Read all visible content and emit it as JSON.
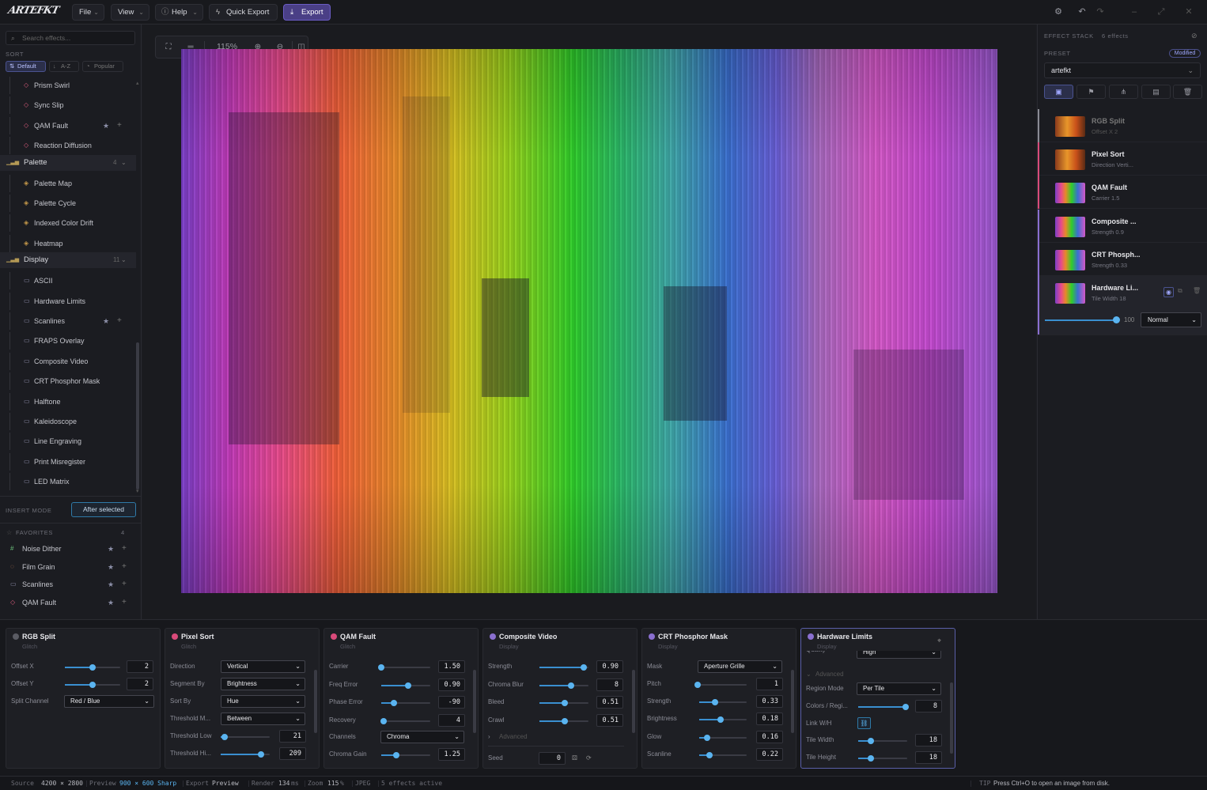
{
  "app": {
    "logo_text": "ARTEFKT"
  },
  "menu": {
    "file": "File",
    "view": "View",
    "help": "Help",
    "quick_export": "Quick Export",
    "export": "Export"
  },
  "sidebar": {
    "search_placeholder": "Search effects...",
    "sort_label": "SORT",
    "sort_options": [
      "Default",
      "A-Z",
      "Popular"
    ],
    "items_top": [
      "Prism Swirl",
      "Sync Slip",
      "QAM Fault",
      "Reaction Diffusion"
    ],
    "palette": {
      "label": "Palette",
      "count": "4",
      "items": [
        "Palette Map",
        "Palette Cycle",
        "Indexed Color Drift",
        "Heatmap"
      ]
    },
    "display": {
      "label": "Display",
      "count": "11",
      "items": [
        "ASCII",
        "Hardware Limits",
        "Scanlines",
        "FRAPS Overlay",
        "Composite Video",
        "CRT Phosphor Mask",
        "Halftone",
        "Kaleidoscope",
        "Line Engraving",
        "Print Misregister",
        "LED Matrix"
      ]
    },
    "insert_mode_label": "INSERT MODE",
    "insert_mode_value": "After selected",
    "favorites_label": "FAVORITES",
    "favorites_count": "4",
    "favorites": [
      "Noise Dither",
      "Film Grain",
      "Scanlines",
      "QAM Fault"
    ]
  },
  "canvas": {
    "zoom": "115%"
  },
  "effect_stack": {
    "title": "EFFECT STACK",
    "count": "6 effects",
    "preset_label": "PRESET",
    "modified": "Modified",
    "preset_value": "artefkt",
    "items": [
      {
        "name": "RGB Split",
        "sub": "Offset X 2",
        "color": "#8a8b94"
      },
      {
        "name": "Pixel Sort",
        "sub": "Direction Verti...",
        "color": "#d94a7a"
      },
      {
        "name": "QAM Fault",
        "sub": "Carrier 1.5",
        "color": "#d94a7a"
      },
      {
        "name": "Composite ...",
        "sub": "Strength 0.9",
        "color": "#8a6fd0"
      },
      {
        "name": "CRT Phosph...",
        "sub": "Strength 0.33",
        "color": "#8a6fd0"
      },
      {
        "name": "Hardware Li...",
        "sub": "Tile Width 18",
        "color": "#8a6fd0"
      }
    ],
    "opacity_value": "100",
    "blend_mode": "Normal"
  },
  "panels": {
    "rgb_split": {
      "title": "RGB Split",
      "category": "Glitch",
      "rows": [
        {
          "k": "Offset X",
          "v": "2",
          "p": 0.5
        },
        {
          "k": "Offset Y",
          "v": "2",
          "p": 0.5
        }
      ],
      "split_label": "Split Channel",
      "split_value": "Red / Blue"
    },
    "pixel_sort": {
      "title": "Pixel Sort",
      "category": "Glitch",
      "rows": [
        {
          "k": "Direction",
          "v": "Vertical"
        },
        {
          "k": "Segment By",
          "v": "Brightness"
        },
        {
          "k": "Sort By",
          "v": "Hue"
        },
        {
          "k": "Threshold M...",
          "v": "Between"
        }
      ],
      "t_low": {
        "k": "Threshold Low",
        "v": "21",
        "p": 0.08
      },
      "t_high": {
        "k": "Threshold Hi...",
        "v": "209",
        "p": 0.82
      }
    },
    "qam_fault": {
      "title": "QAM Fault",
      "category": "Glitch",
      "rows": [
        {
          "k": "Carrier",
          "v": "1.50",
          "p": 0.0
        },
        {
          "k": "Freq Error",
          "v": "0.90",
          "p": 0.55
        },
        {
          "k": "Phase Error",
          "v": "-90",
          "p": 0.25
        },
        {
          "k": "Recovery",
          "v": "4",
          "p": 0.05
        }
      ],
      "channels_label": "Channels",
      "channels_value": "Chroma",
      "gain": {
        "k": "Chroma Gain",
        "v": "1.25",
        "p": 0.3
      }
    },
    "composite": {
      "title": "Composite Video",
      "category": "Display",
      "rows": [
        {
          "k": "Strength",
          "v": "0.90",
          "p": 0.9
        },
        {
          "k": "Chroma Blur",
          "v": "8",
          "p": 0.65
        },
        {
          "k": "Bleed",
          "v": "0.51",
          "p": 0.51
        },
        {
          "k": "Crawl",
          "v": "0.51",
          "p": 0.51
        }
      ],
      "advanced": "Advanced",
      "seed_label": "Seed",
      "seed_value": "0"
    },
    "crt": {
      "title": "CRT Phosphor Mask",
      "category": "Display",
      "mask_label": "Mask",
      "mask_value": "Aperture Grille",
      "pitch": {
        "k": "Pitch",
        "v": "1",
        "p": 0.0
      },
      "rows": [
        {
          "k": "Strength",
          "v": "0.33",
          "p": 0.33
        },
        {
          "k": "Brightness",
          "v": "0.18",
          "p": 0.45
        },
        {
          "k": "Glow",
          "v": "0.16",
          "p": 0.16
        },
        {
          "k": "Scanline",
          "v": "0.22",
          "p": 0.22
        }
      ]
    },
    "hardware": {
      "title": "Hardware Limits",
      "category": "Display",
      "quality_label": "Quality",
      "quality_value": "High",
      "advanced": "Advanced",
      "region_label": "Region Mode",
      "region_value": "Per Tile",
      "colors": {
        "k": "Colors / Regi...",
        "v": "8",
        "p": 0.97
      },
      "link_label": "Link W/H",
      "tile_w": {
        "k": "Tile Width",
        "v": "18",
        "p": 0.25
      },
      "tile_h": {
        "k": "Tile Height",
        "v": "18",
        "p": 0.25
      }
    }
  },
  "status": {
    "source_label": "Source",
    "source_value": "4200 × 2800",
    "preview_label": "Preview",
    "preview_value": "900 × 600 Sharp",
    "export_label": "Export",
    "export_value": "Preview",
    "render_label": "Render",
    "render_value": "134",
    "render_unit": "ms",
    "zoom_label": "Zoom",
    "zoom_value": "115",
    "zoom_unit": "%",
    "format": "JPEG",
    "active": "5 effects active",
    "tip_label": "TIP",
    "tip": "Press Ctrl+O to open an image from disk."
  }
}
